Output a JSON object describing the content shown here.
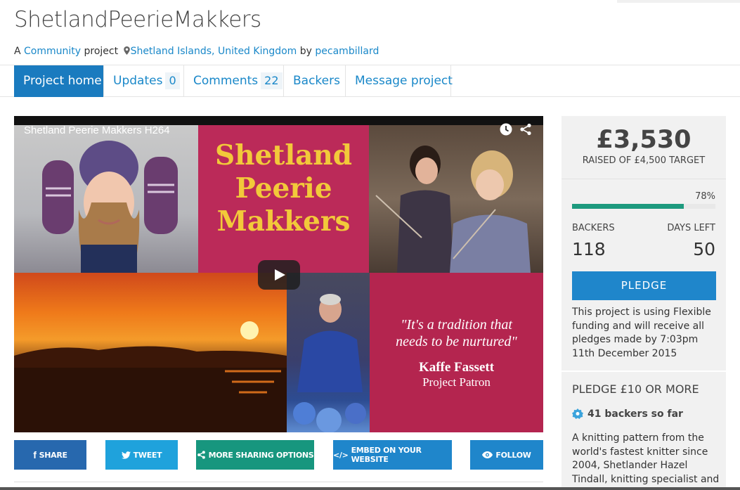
{
  "header": {
    "title": "ShetlandPeerieMakkers",
    "meta_prefix": "A",
    "category": "Community",
    "meta_mid": "project",
    "location": "Shetland Islands, United Kingdom",
    "meta_by": "by",
    "creator": "pecambillard"
  },
  "tabs": [
    {
      "label": "Project home",
      "count": ""
    },
    {
      "label": "Updates",
      "count": "0"
    },
    {
      "label": "Comments",
      "count": "22"
    },
    {
      "label": "Backers",
      "count": ""
    },
    {
      "label": "Message project",
      "count": ""
    }
  ],
  "video": {
    "title": "Shetland Peerie Makkers H264",
    "poster_lines": [
      "Shetland",
      "Peerie",
      "Makkers"
    ],
    "quote_line1": "\"It's a tradition that",
    "quote_line2": "needs to be nurtured\"",
    "quote_name": "Kaffe Fassett",
    "quote_role": "Project Patron"
  },
  "share_buttons": {
    "share": "SHARE",
    "tweet": "TWEET",
    "more": "MORE SHARING OPTIONS",
    "embed": "EMBED ON YOUR WEBSITE",
    "follow": "FOLLOW"
  },
  "stats": {
    "amount": "£3,530",
    "target": "RAISED OF £4,500 TARGET",
    "percent": "78%",
    "percent_value": 78,
    "backers_label": "BACKERS",
    "backers": "118",
    "days_label": "DAYS LEFT",
    "days": "50",
    "pledge_button": "PLEDGE",
    "funding_note": "This project is using Flexible funding and will receive all pledges made by 7:03pm 11th December 2015"
  },
  "reward": {
    "title": "PLEDGE £10 OR MORE",
    "backers": "41 backers so far",
    "description": "A knitting pattern from the world's fastest knitter since 2004, Shetlander Hazel Tindall, knitting specialist and instructor,"
  },
  "colors": {
    "accent": "#1a88c9",
    "tab_active": "#1a7bbf",
    "progress": "#1d9a7e"
  }
}
